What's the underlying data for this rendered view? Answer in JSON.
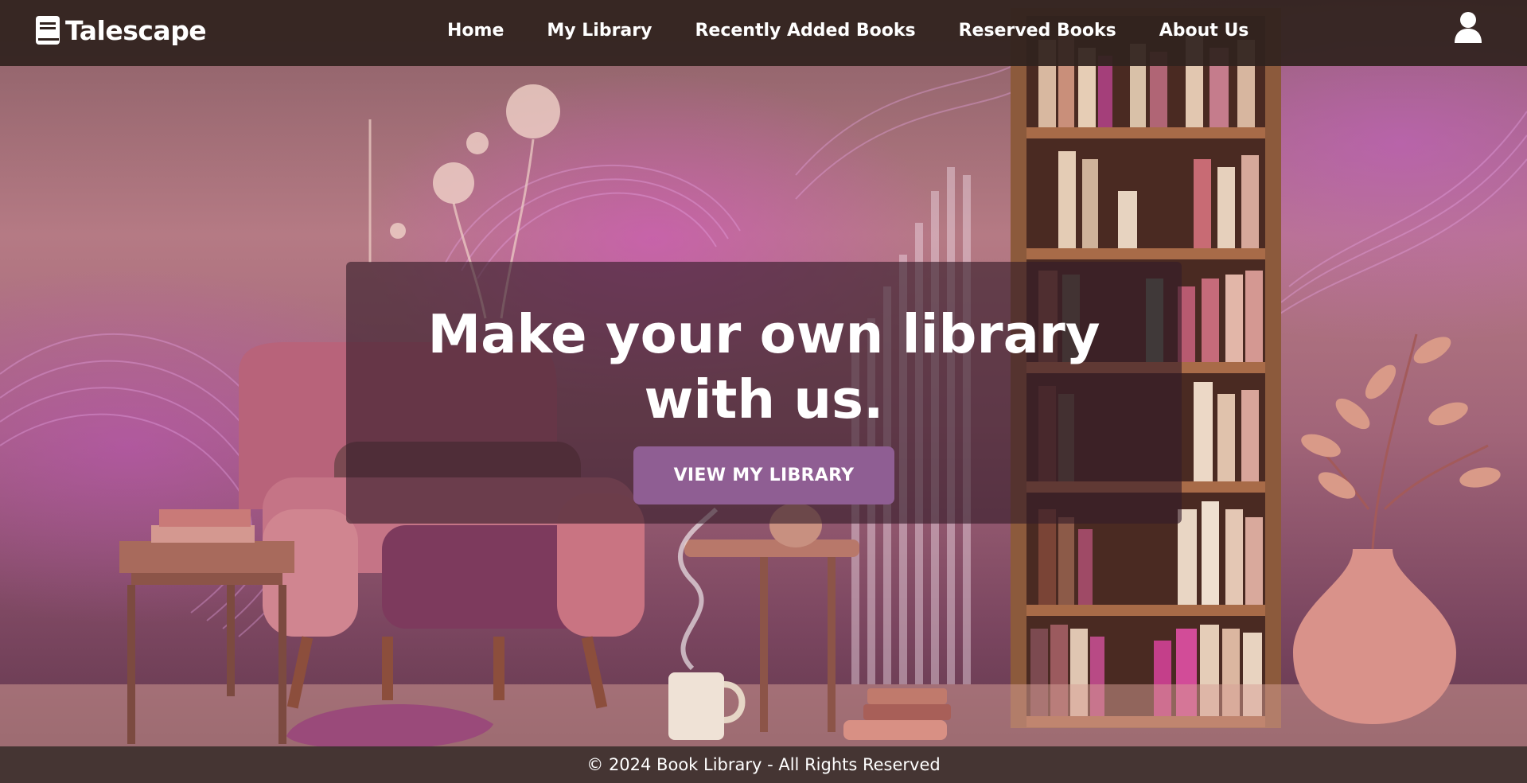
{
  "brand": {
    "name": "Talescape",
    "icon": "book-icon"
  },
  "nav": {
    "links": [
      {
        "label": "Home"
      },
      {
        "label": "My Library"
      },
      {
        "label": "Recently Added Books"
      },
      {
        "label": "Reserved Books"
      },
      {
        "label": "About Us"
      }
    ],
    "user_icon": "user-icon"
  },
  "hero": {
    "title": "Make your own library with us.",
    "button_label": "VIEW MY LIBRARY",
    "image_description": null
  },
  "footer": {
    "text": "© 2024 Book Library - All Rights Reserved"
  },
  "colors": {
    "navbar_bg": "#30221e",
    "button_bg": "#8f5e93",
    "overlay_bg": "#341c28",
    "accent_purple": "#c354c4"
  }
}
